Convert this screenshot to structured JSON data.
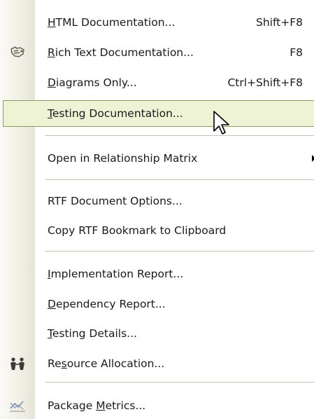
{
  "menu": {
    "items": [
      {
        "pre": "",
        "u": "H",
        "post": "TML Documentation...",
        "shortcut": "Shift+F8"
      },
      {
        "pre": "",
        "u": "R",
        "post": "ich Text Documentation...",
        "shortcut": "F8",
        "icon": "rich-text-doc-icon"
      },
      {
        "pre": "",
        "u": "D",
        "post": "iagrams Only...",
        "shortcut": "Ctrl+Shift+F8"
      },
      {
        "pre": "",
        "u": "T",
        "post": "esting Documentation...",
        "highlighted": true
      },
      {
        "text": "Open in Relationship Matrix",
        "submenu": true
      },
      {
        "text": "RTF Document Options..."
      },
      {
        "text": "Copy RTF Bookmark to Clipboard"
      },
      {
        "pre": "",
        "u": "I",
        "post": "mplementation Report..."
      },
      {
        "pre": "",
        "u": "D",
        "post": "ependency Report..."
      },
      {
        "pre": "",
        "u": "T",
        "post": "esting Details..."
      },
      {
        "pre": "Re",
        "u": "s",
        "post": "ource Allocation...",
        "icon": "resource-allocation-icon"
      },
      {
        "pre": "Package ",
        "u": "M",
        "post": "etrics...",
        "icon": "package-metrics-icon"
      }
    ]
  },
  "colors": {
    "highlight_bg": "#eef3d6",
    "highlight_border": "#8a9a61",
    "separator": "#c5c2b2"
  }
}
